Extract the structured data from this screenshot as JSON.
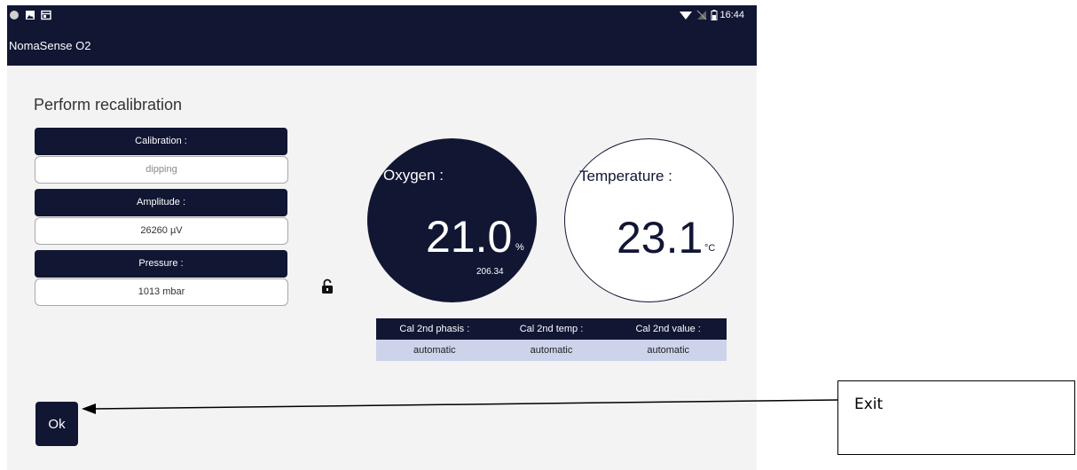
{
  "statusbar": {
    "time": "16:44",
    "left_icons": [
      "circle-icon",
      "image-icon",
      "window-icon"
    ],
    "right_icons": [
      "wifi-icon",
      "no-signal-icon",
      "battery-icon"
    ]
  },
  "app": {
    "title": "NomaSense O2"
  },
  "page": {
    "heading": "Perform recalibration"
  },
  "fields": {
    "calibration": {
      "label": "Calibration :",
      "value": "dipping"
    },
    "amplitude": {
      "label": "Amplitude :",
      "value": "26260 µV"
    },
    "pressure": {
      "label": "Pressure :",
      "value": "1013 mbar"
    }
  },
  "oxygen": {
    "label": "Oxygen :",
    "value": "21.0",
    "unit": "%",
    "sub_value": "206.34"
  },
  "temperature": {
    "label": "Temperature :",
    "value": "23.1",
    "unit": "°C"
  },
  "cal_table": {
    "headers": [
      "Cal 2nd phasis :",
      "Cal 2nd temp :",
      "Cal 2nd value :"
    ],
    "values": [
      "automatic",
      "automatic",
      "automatic"
    ]
  },
  "actions": {
    "ok_label": "Ok"
  },
  "annotation": {
    "callout_text": "Exit"
  },
  "colors": {
    "primary": "#111633",
    "table_body": "#ccd3ea",
    "background": "#f3f3f3"
  }
}
